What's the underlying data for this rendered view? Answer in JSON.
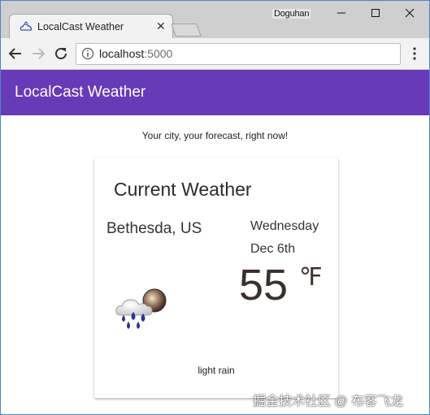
{
  "browser": {
    "tab_title": "LocalCast Weather",
    "profile_name": "Doguhan",
    "url_host": "localhost",
    "url_port": ":5000",
    "accent": "#4a86c7"
  },
  "app": {
    "title": "LocalCast Weather",
    "tagline": "Your city, your forecast, right now!",
    "primary_color": "#673ab7"
  },
  "weather_card": {
    "heading": "Current Weather",
    "city": "Bethesda, US",
    "day": "Wednesday",
    "date": "Dec 6th",
    "temperature": "55",
    "unit": "℉",
    "description": "light rain",
    "icon": "light-rain-icon"
  },
  "watermark": "掘金技术社区 @ 布客飞龙"
}
